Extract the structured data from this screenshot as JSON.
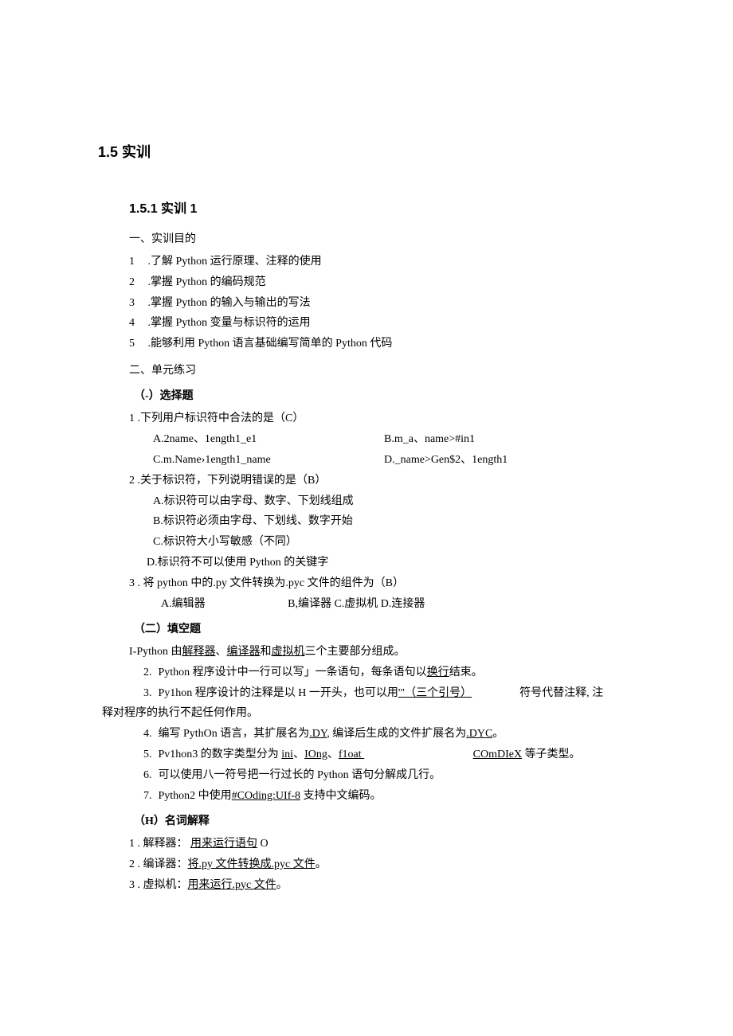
{
  "headings": {
    "main": "1.5 实训",
    "sub": "1.5.1   实训 1"
  },
  "section1": {
    "title": "一、实训目的",
    "items": [
      {
        "num": "1",
        "text": " .了解 Python 运行原理、注释的使用"
      },
      {
        "num": "2",
        "text": "  .掌握 Python 的编码规范"
      },
      {
        "num": "3",
        "text": "  .掌握 Python 的输入与输出的写法"
      },
      {
        "num": "4",
        "text": "  .掌握 Python 变量与标识符的运用"
      },
      {
        "num": "5",
        "text": "  .能够利用 Python 语言基础编写简单的 Python 代码"
      }
    ]
  },
  "section2": {
    "title": "二、单元练习",
    "choice_title": "（-）选择题",
    "q1": {
      "stem": "1  .下列用户标识符中合法的是（C）",
      "optA": "A.2name、1ength1_e1",
      "optB": "B.m_a、name>#in1",
      "optC": "C.m.Name›1ength1_name",
      "optD": "D._name>Gen$2、1ength1"
    },
    "q2": {
      "stem": "2   .关于标识符，下列说明错误的是（B）",
      "optA": "A.标识符可以由字母、数字、下划线组成",
      "optB": "B.标识符必须由字母、下划线、数字开始",
      "optC": "C.标识符大小写敏感（不同）",
      "optD": "D.标识符不可以使用 Python 的关键字"
    },
    "q3": {
      "stem": "3   . 将 python 中的.py 文件转换为.pyc 文件的组件为（B）",
      "optA": "A.编辑器",
      "optBCD": "B,编译器 C.虚拟机 D.连接器"
    },
    "fill_title": "（二）填空题",
    "fill1_pre": "I-Python 由",
    "fill1_u1": "解释器",
    "fill1_mid1": "、",
    "fill1_u2": "编译器",
    "fill1_mid2": "和",
    "fill1_u3": "虚拟机",
    "fill1_post": "三个主要部分组成。",
    "fill2_num": "2.",
    "fill2_pre": "Python 程序设计中一行可以写」一条语句，每条语句以",
    "fill2_u": "换行",
    "fill2_post": "结束。",
    "fill3_num": "3.",
    "fill3_pre": "Py1hon 程序设计的注释是以 H 一开头，也可以用",
    "fill3_u": "'\"（三个引号）",
    "fill3_post": "符号代替注释, 注",
    "fill3_line2": "释对程序的执行不起任何作用。",
    "fill4_num": "4.",
    "fill4_pre": "编写 PythOn 语言，其扩展名为",
    "fill4_u1": ".DY",
    "fill4_mid": ", 编译后生成的文件扩展名为",
    "fill4_u2": ".DYC",
    "fill4_post": "。",
    "fill5_num": "5.",
    "fill5_pre": "Pv1hon3 的数字类型分为    ",
    "fill5_u1": "ini",
    "fill5_mid1": "、",
    "fill5_u2": "IOng",
    "fill5_mid2": "、",
    "fill5_u3": "f1oat",
    "fill5_mid3": "",
    "fill5_u4": "COmDIeX",
    "fill5_post": " 等子类型。",
    "fill6_num": "6.",
    "fill6_text": "可以使用八一符号把一行过长的 Python 语句分解成几行。",
    "fill7_num": "7.",
    "fill7_pre": "Python2 中使用",
    "fill7_u": "#COding:UIf-8",
    "fill7_post": "       支持中文编码。",
    "term_title": "（H）名词解释",
    "term1_pre": "1   . 解释器：  ",
    "term1_u": "用来运行语句",
    "term1_post": " O",
    "term2_pre": "2   . 编译器：",
    "term2_u": "将.py 文件转换成.pyc 文件",
    "term2_post": "。",
    "term3_pre": "3   . 虚拟机：",
    "term3_u": "用来运行.pyc 文件",
    "term3_post": "。"
  }
}
